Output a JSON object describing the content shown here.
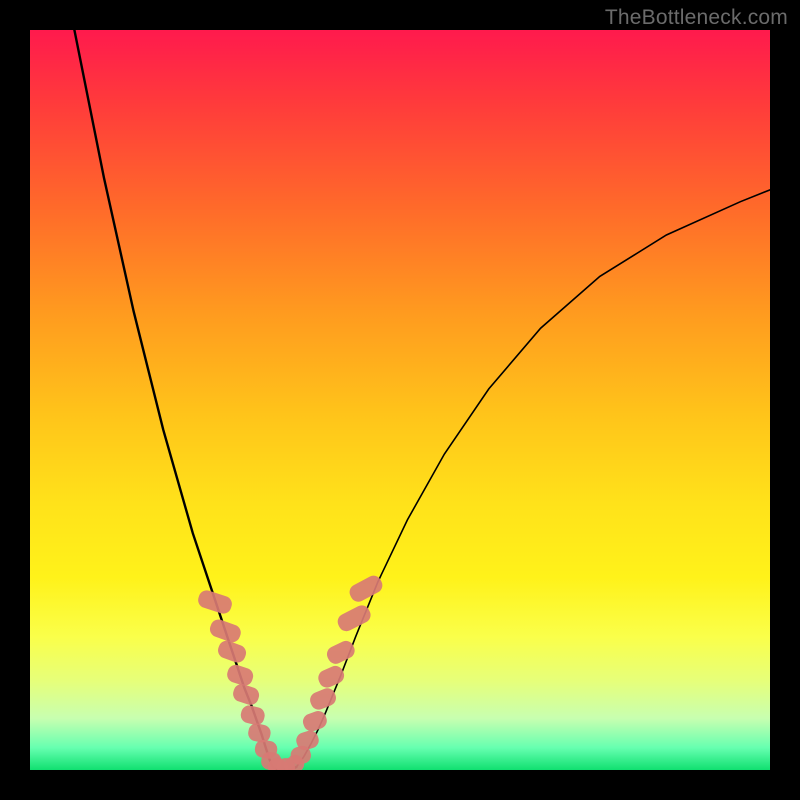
{
  "watermark": "TheBottleneck.com",
  "chart_data": {
    "type": "line",
    "title": "",
    "subtitle": "",
    "xlabel": "",
    "ylabel": "",
    "xlim": [
      0,
      100
    ],
    "ylim": [
      0,
      100
    ],
    "grid": false,
    "legend": false,
    "annotations": [],
    "background_gradient": {
      "description": "red (top) → orange → yellow → green (bottom)",
      "stops": [
        {
          "pos": 0,
          "color": "#ff1a4d"
        },
        {
          "pos": 10,
          "color": "#ff3b3b"
        },
        {
          "pos": 24,
          "color": "#ff6a2a"
        },
        {
          "pos": 38,
          "color": "#ff9a1f"
        },
        {
          "pos": 52,
          "color": "#ffc41a"
        },
        {
          "pos": 64,
          "color": "#ffe21a"
        },
        {
          "pos": 74,
          "color": "#fff21a"
        },
        {
          "pos": 82,
          "color": "#faff4a"
        },
        {
          "pos": 88,
          "color": "#e6ff7a"
        },
        {
          "pos": 93,
          "color": "#c8ffb0"
        },
        {
          "pos": 97,
          "color": "#66ffb0"
        },
        {
          "pos": 100,
          "color": "#10e070"
        }
      ]
    },
    "series": [
      {
        "name": "v-curve-left",
        "stroke": "#000000",
        "stroke_width": 2.4,
        "x": [
          6,
          8,
          10,
          12,
          14,
          16,
          18,
          20,
          22,
          24,
          26,
          27,
          28,
          29,
          30,
          30.7,
          31.3,
          31.8,
          32.3,
          32.8
        ],
        "y": [
          100,
          90,
          80,
          71,
          62,
          54,
          46,
          39,
          32,
          26,
          20,
          17,
          14,
          11,
          8.5,
          6.5,
          4.8,
          3.2,
          1.6,
          0.4
        ]
      },
      {
        "name": "v-curve-right",
        "stroke": "#000000",
        "stroke_width": 1.6,
        "x": [
          36,
          37,
          38,
          39,
          40,
          42,
          44,
          47,
          51,
          56,
          62,
          69,
          77,
          86,
          96,
          100
        ],
        "y": [
          0.4,
          1.8,
          3.6,
          5.6,
          7.9,
          12.8,
          18.0,
          25.4,
          33.8,
          42.7,
          51.5,
          59.7,
          66.7,
          72.3,
          76.8,
          78.4
        ]
      },
      {
        "name": "floor",
        "stroke": "#000000",
        "stroke_width": 2.4,
        "x": [
          32.8,
          33.4,
          34.0,
          34.7,
          35.3,
          36.0
        ],
        "y": [
          0.4,
          0.1,
          0.0,
          0.0,
          0.1,
          0.4
        ]
      }
    ],
    "markers": {
      "name": "beads",
      "shape": "rounded-rect",
      "fill": "#d87a74",
      "opacity": 0.92,
      "points": [
        {
          "x": 25.0,
          "y": 22.7,
          "w": 2.4,
          "h": 4.6,
          "angle": -72
        },
        {
          "x": 26.4,
          "y": 18.8,
          "w": 2.4,
          "h": 4.2,
          "angle": -70
        },
        {
          "x": 27.3,
          "y": 16.0,
          "w": 2.4,
          "h": 3.8,
          "angle": -70
        },
        {
          "x": 28.4,
          "y": 12.8,
          "w": 2.4,
          "h": 3.5,
          "angle": -72
        },
        {
          "x": 29.2,
          "y": 10.2,
          "w": 2.4,
          "h": 3.5,
          "angle": -72
        },
        {
          "x": 30.1,
          "y": 7.4,
          "w": 2.4,
          "h": 3.2,
          "angle": -76
        },
        {
          "x": 31.0,
          "y": 5.0,
          "w": 2.4,
          "h": 3.0,
          "angle": -78
        },
        {
          "x": 31.9,
          "y": 2.8,
          "w": 2.4,
          "h": 3.0,
          "angle": -80
        },
        {
          "x": 32.6,
          "y": 1.2,
          "w": 2.4,
          "h": 2.7,
          "angle": -82
        },
        {
          "x": 33.5,
          "y": 0.35,
          "w": 2.4,
          "h": 2.7,
          "angle": -45
        },
        {
          "x": 34.6,
          "y": 0.25,
          "w": 2.4,
          "h": 2.7,
          "angle": 0
        },
        {
          "x": 35.7,
          "y": 0.7,
          "w": 2.4,
          "h": 2.7,
          "angle": 45
        },
        {
          "x": 36.6,
          "y": 2.0,
          "w": 2.4,
          "h": 2.7,
          "angle": 74
        },
        {
          "x": 37.5,
          "y": 4.0,
          "w": 2.4,
          "h": 3.0,
          "angle": 72
        },
        {
          "x": 38.5,
          "y": 6.6,
          "w": 2.4,
          "h": 3.2,
          "angle": 70
        },
        {
          "x": 39.6,
          "y": 9.6,
          "w": 2.4,
          "h": 3.5,
          "angle": 68
        },
        {
          "x": 40.7,
          "y": 12.6,
          "w": 2.4,
          "h": 3.5,
          "angle": 66
        },
        {
          "x": 42.0,
          "y": 15.9,
          "w": 2.4,
          "h": 3.8,
          "angle": 64
        },
        {
          "x": 43.8,
          "y": 20.5,
          "w": 2.4,
          "h": 4.6,
          "angle": 63
        },
        {
          "x": 45.4,
          "y": 24.5,
          "w": 2.4,
          "h": 4.6,
          "angle": 62
        }
      ]
    }
  }
}
